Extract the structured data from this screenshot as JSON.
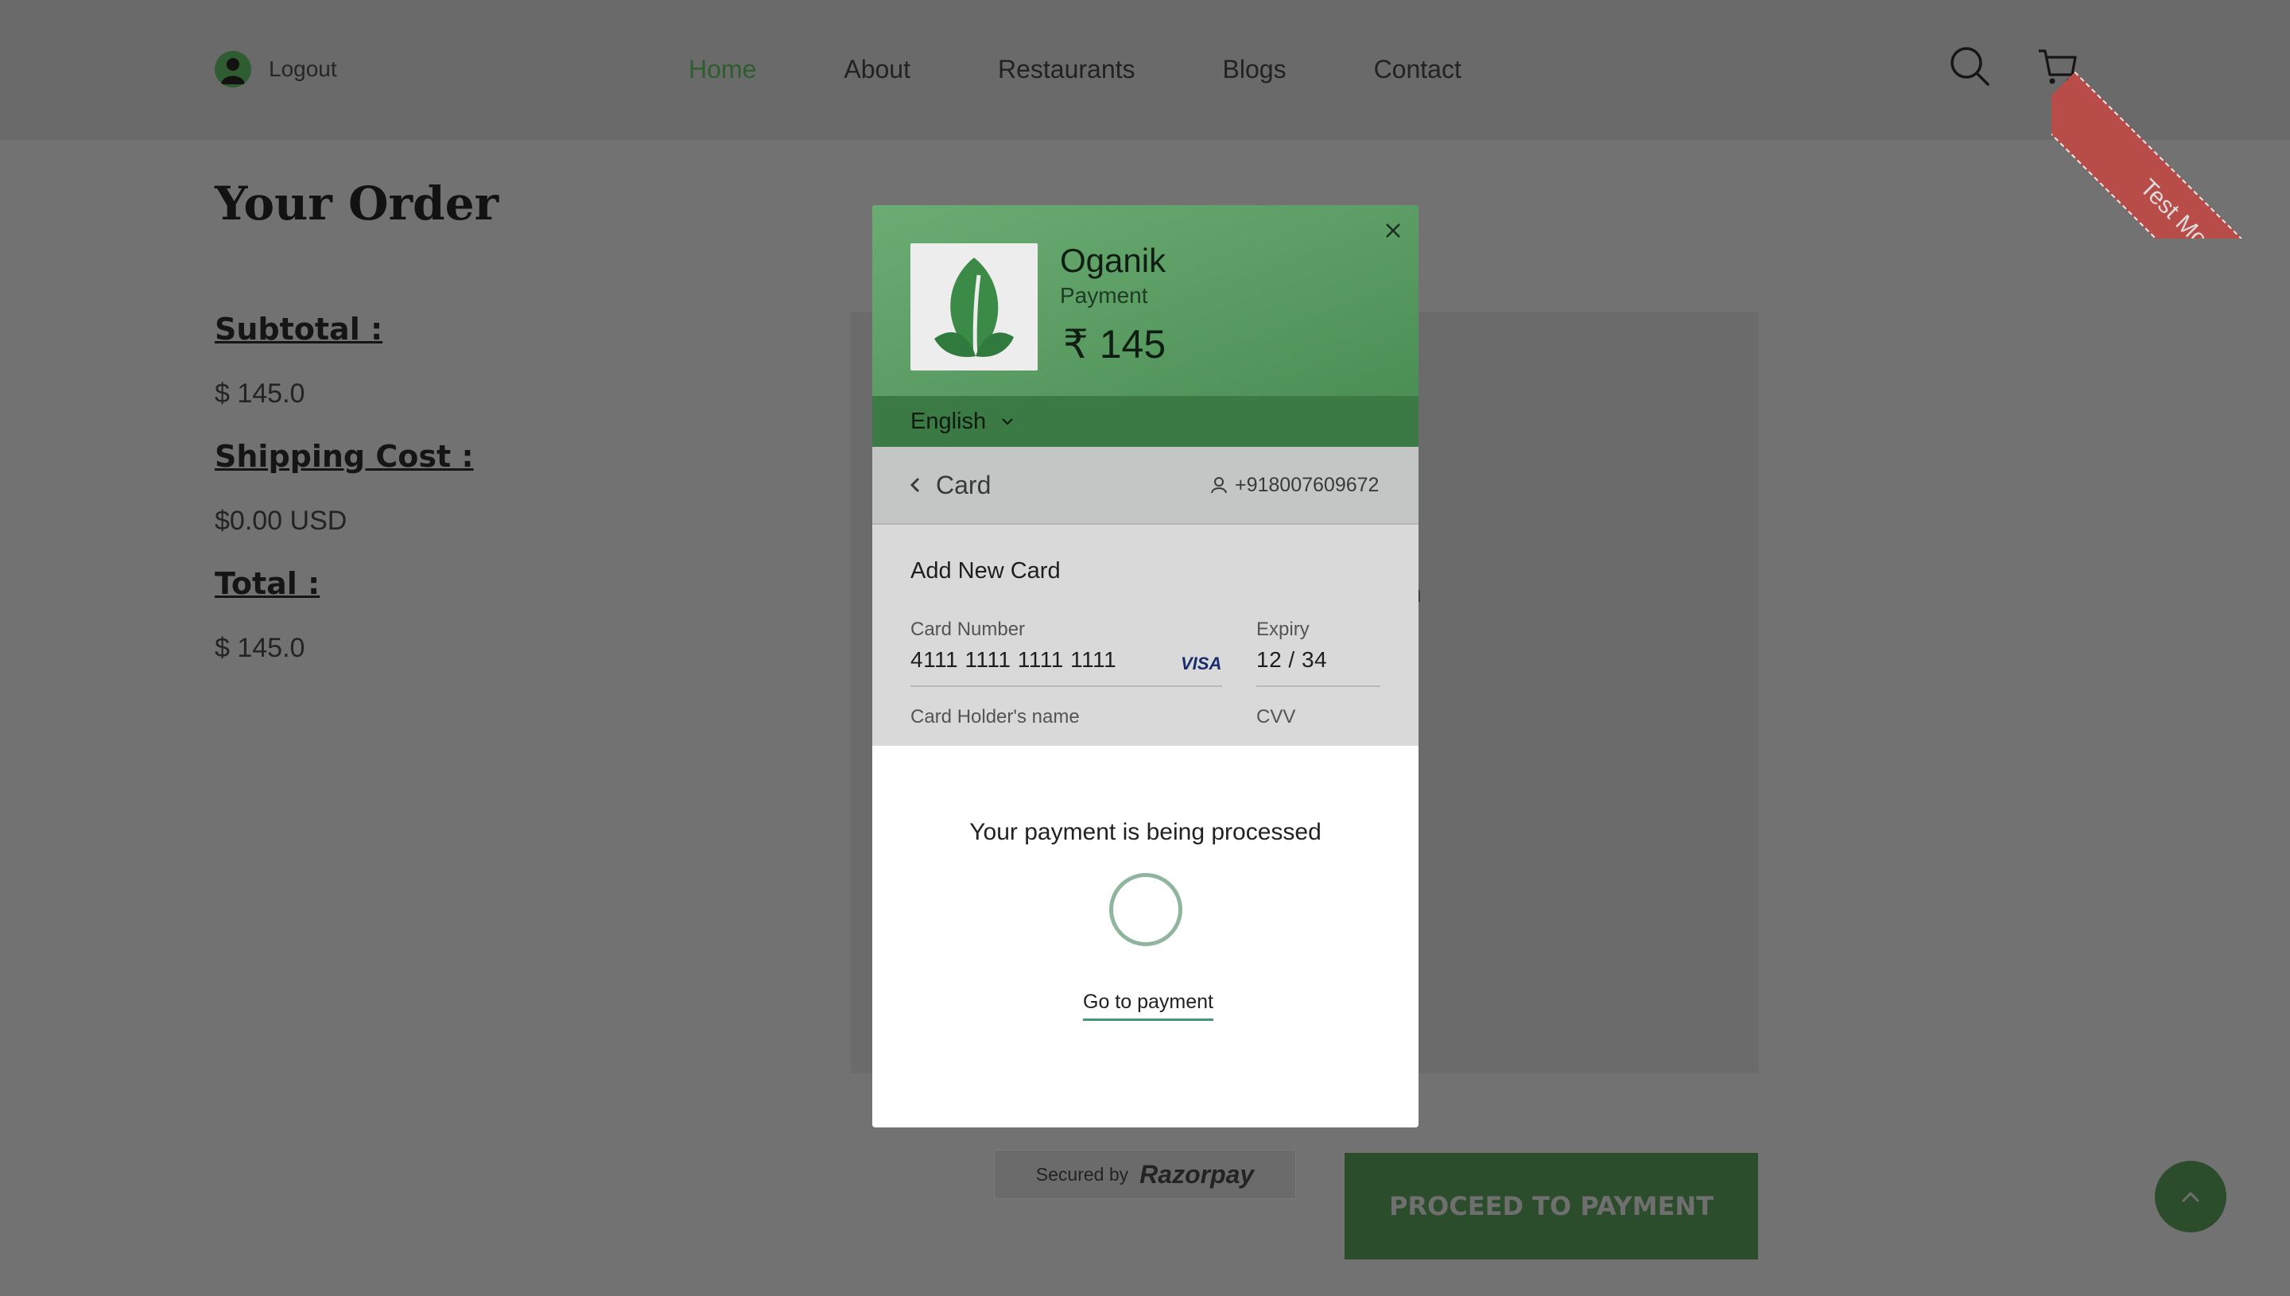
{
  "header": {
    "account_label": "Logout",
    "nav": [
      {
        "label": "Home",
        "active": true
      },
      {
        "label": "About",
        "active": false
      },
      {
        "label": "Restaurants",
        "active": false
      },
      {
        "label": "Blogs",
        "active": false
      },
      {
        "label": "Contact",
        "active": false
      }
    ],
    "icons": [
      "search-icon",
      "cart-icon"
    ],
    "ribbon": "Test Mode"
  },
  "order": {
    "title": "Your Order",
    "subtotal_label": "Subtotal :",
    "subtotal_value": "$ 145.0",
    "shipping_label": "Shipping Cost :",
    "shipping_value": "$0.00 USD",
    "total_label": "Total :",
    "total_value": "$ 145.0",
    "partial_text": "an",
    "proceed_label": "PROCEED TO PAYMENT"
  },
  "secured": {
    "label": "Secured by",
    "brand": "Razorpay"
  },
  "modal": {
    "merchant": "Oganik",
    "subtitle": "Payment",
    "amount": "₹ 145",
    "language": "English",
    "section": "Card",
    "contact": "+918007609672",
    "add_card": "Add New Card",
    "card_number_label": "Card Number",
    "card_number_value": "4111 1111 1111 1111",
    "card_brand": "VISA",
    "expiry_label": "Expiry",
    "expiry_value": "12 / 34",
    "holder_label": "Card Holder's name",
    "cvv_label": "CVV",
    "processing_text": "Your payment is being processed",
    "go_to_payment": "Go to payment"
  },
  "colors": {
    "accent_green": "#4c8f55",
    "dark_green": "#2b4d2b",
    "ribbon_red": "#b84c49"
  }
}
